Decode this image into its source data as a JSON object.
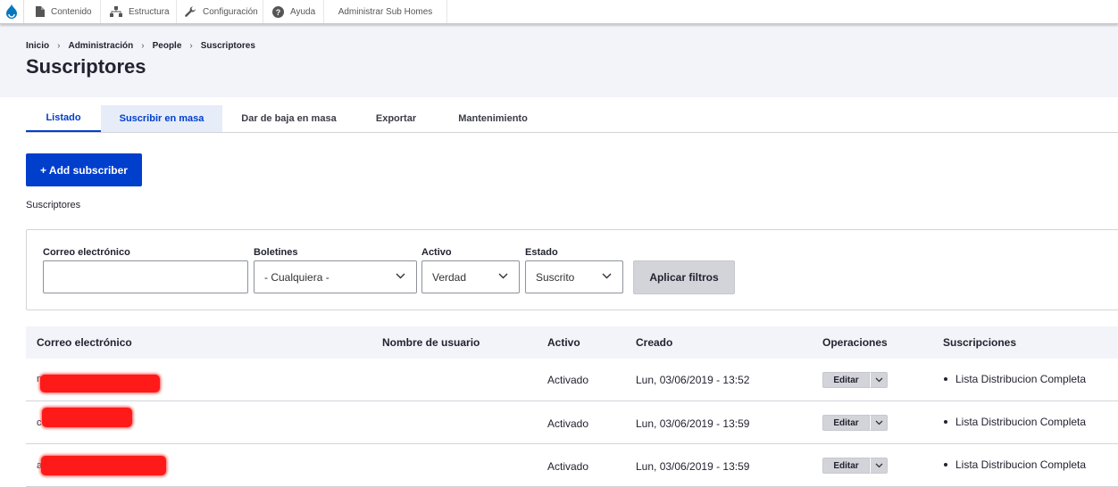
{
  "toolbar": {
    "items": [
      {
        "label": "Contenido",
        "icon": "file-icon"
      },
      {
        "label": "Estructura",
        "icon": "sitemap-icon"
      },
      {
        "label": "Configuración",
        "icon": "wrench-icon"
      },
      {
        "label": "Ayuda",
        "icon": "help-icon"
      },
      {
        "label": "Administrar Sub Homes",
        "icon": ""
      }
    ]
  },
  "breadcrumb": [
    "Inicio",
    "Administración",
    "People",
    "Suscriptores"
  ],
  "page_title": "Suscriptores",
  "tabs": [
    "Listado",
    "Suscribir en masa",
    "Dar de baja en masa",
    "Exportar",
    "Mantenimiento"
  ],
  "add_button": "+ Add subscriber",
  "section_label": "Suscriptores",
  "filters": {
    "email_label": "Correo electrónico",
    "email_value": "",
    "newsletters_label": "Boletines",
    "newsletters_value": "- Cualquiera -",
    "active_label": "Activo",
    "active_value": "Verdad",
    "status_label": "Estado",
    "status_value": "Suscrito",
    "apply_label": "Aplicar filtros"
  },
  "table": {
    "headers": [
      "Correo electrónico",
      "Nombre de usuario",
      "Activo",
      "Creado",
      "Operaciones",
      "Suscripciones"
    ],
    "rows": [
      {
        "email_visible": "m",
        "active": "Activado",
        "created": "Lun, 03/06/2019 - 13:52",
        "edit": "Editar",
        "subscription": "Lista Distribucion Completa"
      },
      {
        "email_visible": "c",
        "active": "Activado",
        "created": "Lun, 03/06/2019 - 13:59",
        "edit": "Editar",
        "subscription": "Lista Distribucion Completa"
      },
      {
        "email_visible": "a",
        "active": "Activado",
        "created": "Lun, 03/06/2019 - 13:59",
        "edit": "Editar",
        "subscription": "Lista Distribucion Completa"
      }
    ]
  },
  "colors": {
    "primary": "#003ecc",
    "header_bg": "#f3f4f9",
    "redaction": "#ff1a1a"
  }
}
